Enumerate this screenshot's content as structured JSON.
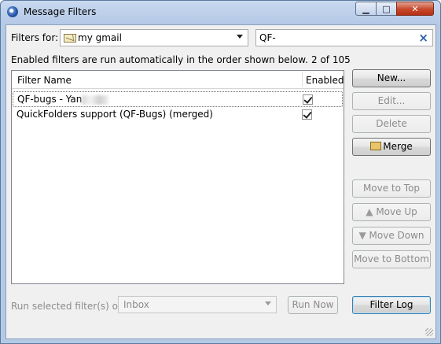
{
  "window": {
    "title": "Message Filters"
  },
  "filters_for": {
    "label": "Filters for:",
    "account": "my gmail",
    "search_value": "QF-",
    "clear_icon": "×"
  },
  "info": {
    "description": "Enabled filters are run automatically in the order shown below.",
    "count": "2 of 105"
  },
  "list": {
    "columns": {
      "name": "Filter Name",
      "enabled": "Enabled"
    },
    "rows": [
      {
        "name": "QF-bugs - Yan",
        "enabled": true
      },
      {
        "name": "QuickFolders support (QF-Bugs) (merged)",
        "enabled": true
      }
    ]
  },
  "buttons": {
    "new": "New...",
    "edit": "Edit...",
    "delete": "Delete",
    "merge": "Merge",
    "move_to_top": "Move to Top",
    "move_up": "Move Up",
    "move_down": "Move Down",
    "move_to_bottom": "Move to Bottom",
    "run_now": "Run Now",
    "filter_log": "Filter Log"
  },
  "run_selected": {
    "label": "Run selected filter(s) on:",
    "folder": "Inbox"
  },
  "icons": {
    "app": "thunderbird-icon",
    "account": "envelope-icon",
    "merge": "merge-icon",
    "up": "arrow-up-icon",
    "down": "arrow-down-icon"
  }
}
